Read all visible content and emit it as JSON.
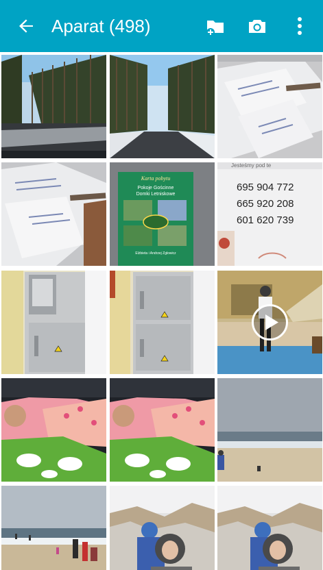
{
  "appbar": {
    "title": "Aparat (498)",
    "back_icon": "arrow-left-icon",
    "folder_icon": "add-folder-icon",
    "camera_icon": "camera-icon",
    "more_icon": "more-vert-icon",
    "color": "#00a3c4"
  },
  "photos": {
    "count": 15,
    "phone_numbers": [
      "695 904 772",
      "665 920 208",
      "601 620 739"
    ],
    "sign_header": "Jesteśmy pod te",
    "card_title": "Karta pobytu",
    "card_lines": [
      "Pokoje Gościnne",
      "Domki Letniskowe"
    ],
    "card_owner": "Elżbieta i Andrzej Zglowicz",
    "video_icon": "play-icon"
  }
}
